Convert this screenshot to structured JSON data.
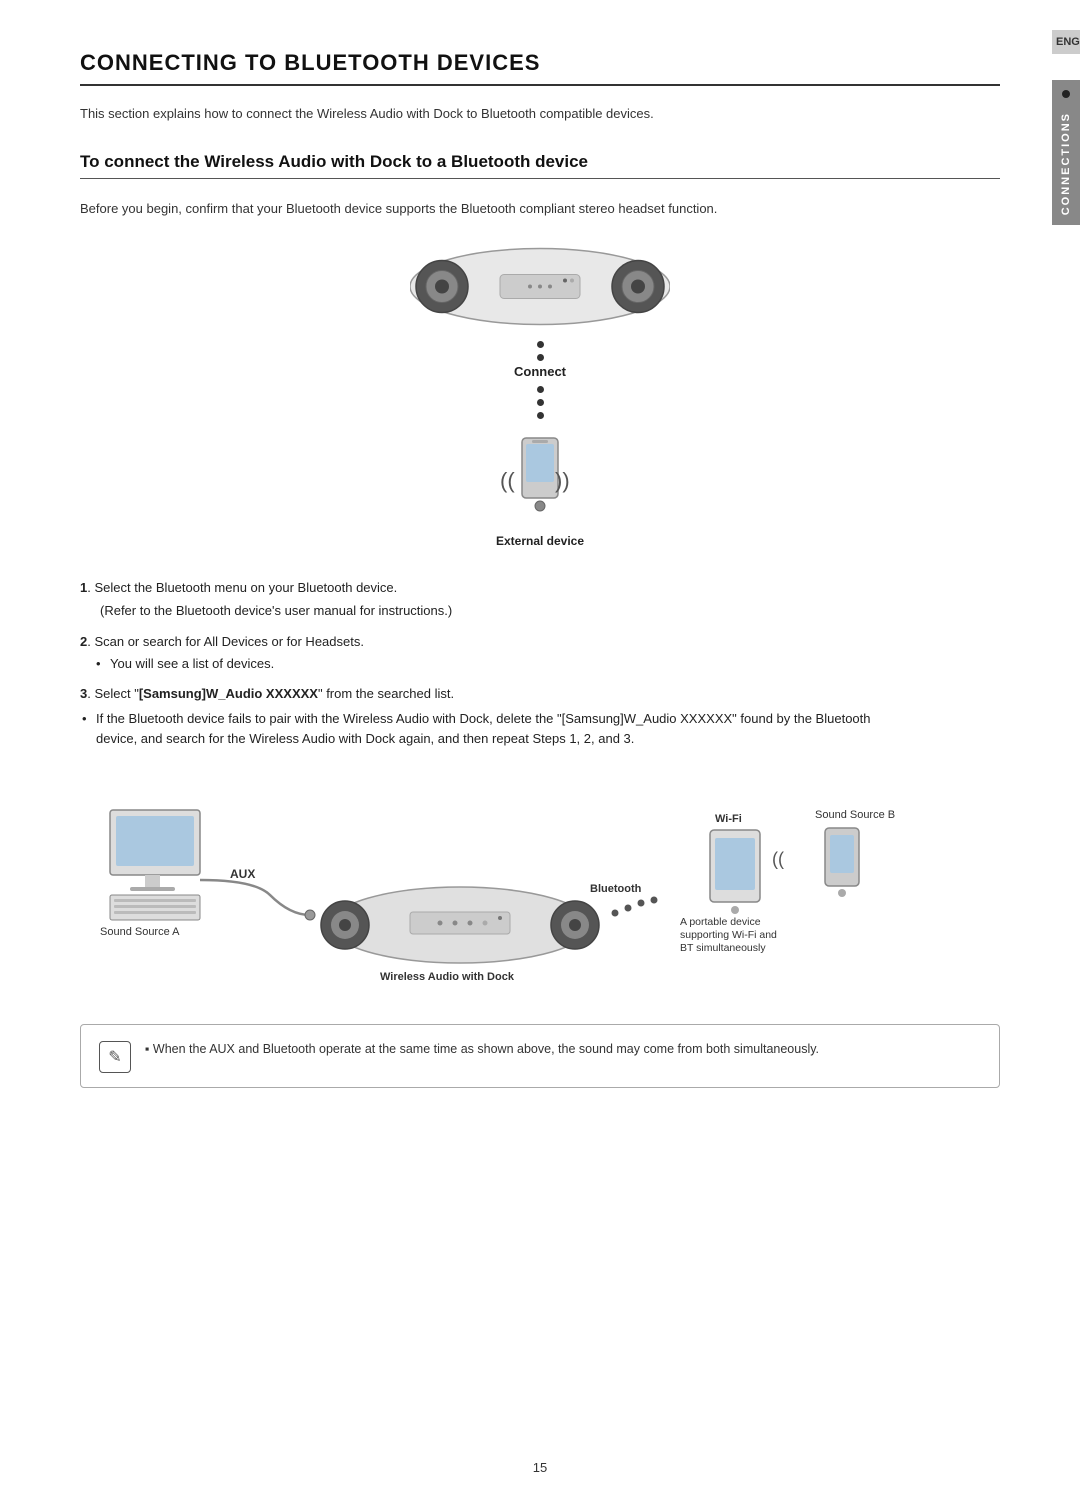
{
  "page": {
    "number": "15",
    "background": "#ffffff"
  },
  "sidebar": {
    "eng_label": "ENG",
    "connections_label": "CONNECTIONS"
  },
  "main_title": "CONNECTING TO BLUETOOTH DEVICES",
  "intro_text": "This section explains how to connect the Wireless Audio with Dock to Bluetooth compatible devices.",
  "section_heading": "To connect the Wireless Audio with Dock to a Bluetooth device",
  "sub_intro": "Before you begin, confirm that your Bluetooth device supports the Bluetooth compliant stereo headset function.",
  "diagram": {
    "connect_label": "Connect",
    "external_device_label": "External device"
  },
  "steps": [
    {
      "number": "1",
      "text": "Select the Bluetooth menu on your Bluetooth device.",
      "sub": "(Refer to the Bluetooth device's user manual for instructions.)"
    },
    {
      "number": "2",
      "text": "Scan or search for All Devices or for Headsets.",
      "bullet": "You will see a list of devices."
    },
    {
      "number": "3",
      "text_before": "Select \"",
      "bold_text": "[Samsung]W_Audio XXXXXX",
      "text_after": "\" from the searched list.",
      "bullet": "If the Bluetooth device fails to pair with the Wireless Audio with Dock, delete the \"[Samsung]W_Audio XXXXXX\" found by the Bluetooth device, and search for the Wireless Audio with Dock again, and then repeat Steps 1, 2, and 3."
    }
  ],
  "bottom_diagram": {
    "sound_source_a_label": "Sound Source A",
    "aux_label": "AUX",
    "bluetooth_label": "Bluetooth",
    "wifi_label": "Wi-Fi",
    "portable_device_label": "A portable device\nsupporting Wi-Fi and\nBT simultaneously",
    "sound_source_b_label": "Sound Source B",
    "wireless_audio_label": "Wireless Audio with Dock"
  },
  "note": {
    "icon": "✎",
    "text": "When the AUX and Bluetooth operate at the same time as shown above, the sound may come from both simultaneously."
  }
}
